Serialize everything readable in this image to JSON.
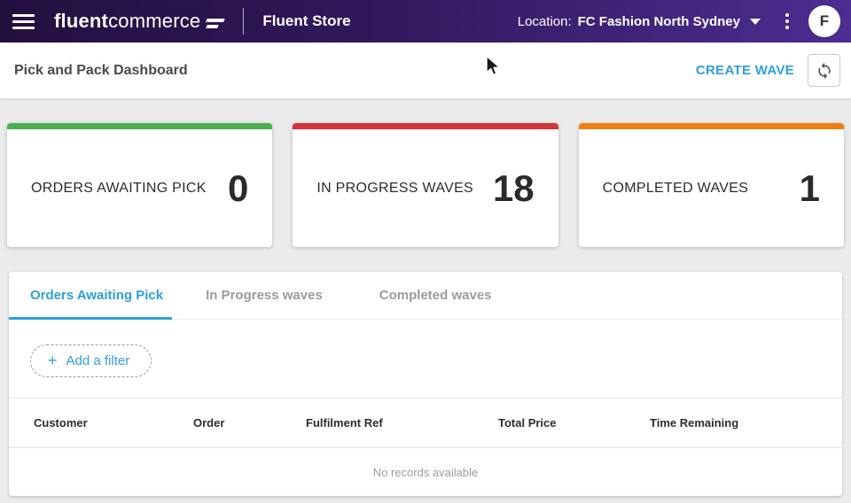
{
  "navbar": {
    "logo_bold": "fluent",
    "logo_light": "commerce",
    "app_title": "Fluent Store",
    "location_label": "Location:",
    "location_value": "FC Fashion North Sydney",
    "avatar_initial": "F"
  },
  "header": {
    "title": "Pick and Pack Dashboard",
    "create_wave_label": "CREATE WAVE"
  },
  "stat_cards": [
    {
      "label": "ORDERS AWAITING PICK",
      "value": "0",
      "accent": "#4caf50"
    },
    {
      "label": "IN PROGRESS WAVES",
      "value": "18",
      "accent": "#d0343c"
    },
    {
      "label": "COMPLETED WAVES",
      "value": "1",
      "accent": "#f07d13"
    }
  ],
  "tabs": [
    {
      "label": "Orders Awaiting Pick",
      "active": true
    },
    {
      "label": "In Progress waves",
      "active": false
    },
    {
      "label": "Completed waves",
      "active": false
    }
  ],
  "filter": {
    "plus": "+",
    "label": "Add a filter"
  },
  "table": {
    "columns": [
      "Customer",
      "Order",
      "Fulfilment Ref",
      "Total Price",
      "Time Remaining"
    ],
    "empty_message": "No records available"
  },
  "colors": {
    "accent_blue": "#2e9fd9",
    "navbar_gradient_start": "#23103f",
    "navbar_gradient_end": "#4c2d91",
    "card_green": "#4caf50",
    "card_red": "#d0343c",
    "card_orange": "#f07d13"
  }
}
